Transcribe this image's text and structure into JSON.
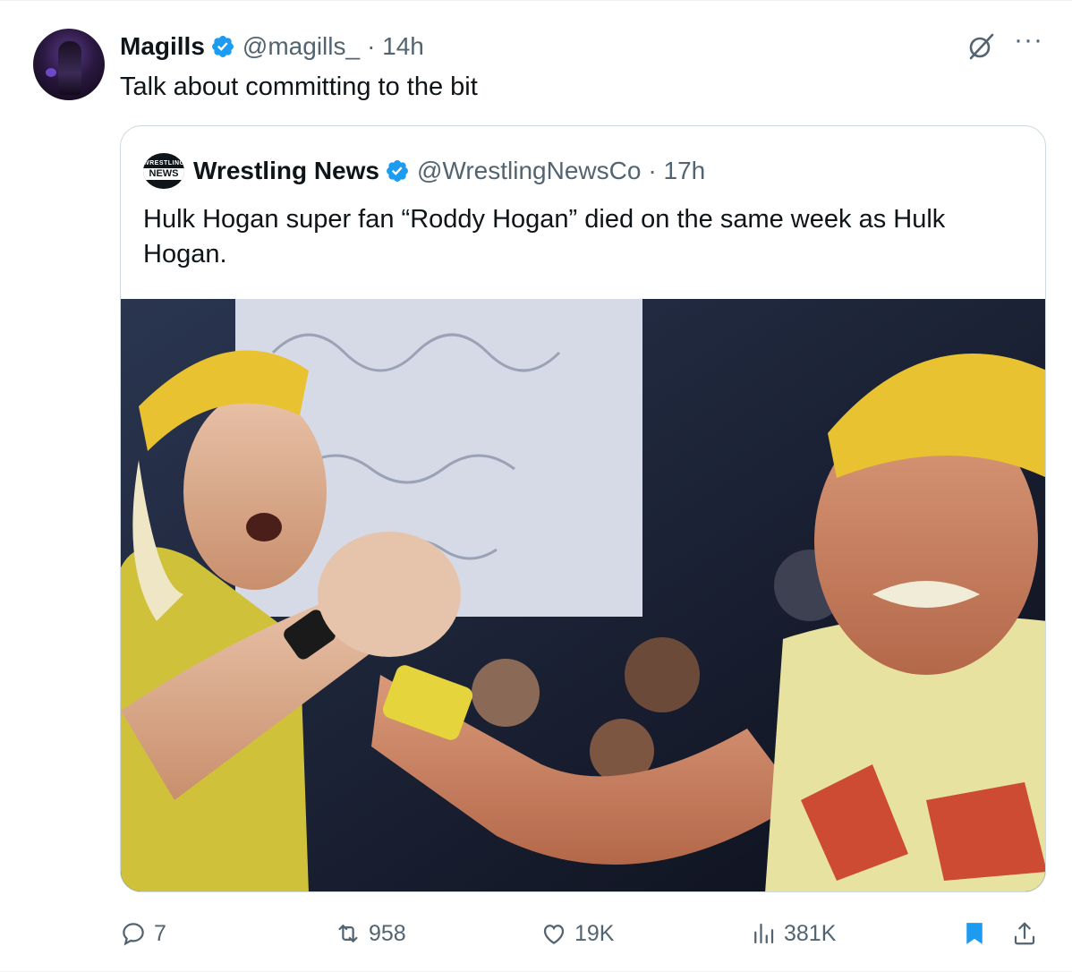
{
  "tweet": {
    "display_name": "Magills",
    "handle": "@magills_",
    "time": "· 14h",
    "text": "Talk about committing to the bit"
  },
  "quoted": {
    "logo_line1": "WRESTLING",
    "logo_line2": "NEWS",
    "display_name": "Wrestling News",
    "handle": "@WrestlingNewsCo",
    "time": "· 17h",
    "text": "Hulk Hogan super fan “Roddy Hogan” died on the same week as Hulk Hogan."
  },
  "actions": {
    "replies": "7",
    "reposts": "958",
    "likes": "19K",
    "views": "381K"
  },
  "colors": {
    "verified": "#1d9bf0",
    "bookmark_active": "#1d9bf0",
    "secondary_text": "#536471",
    "border": "#cfd9de"
  },
  "icons": [
    "verified-badge-icon",
    "grok-icon",
    "more-icon",
    "reply-icon",
    "repost-icon",
    "like-icon",
    "views-icon",
    "bookmark-icon",
    "share-icon"
  ]
}
